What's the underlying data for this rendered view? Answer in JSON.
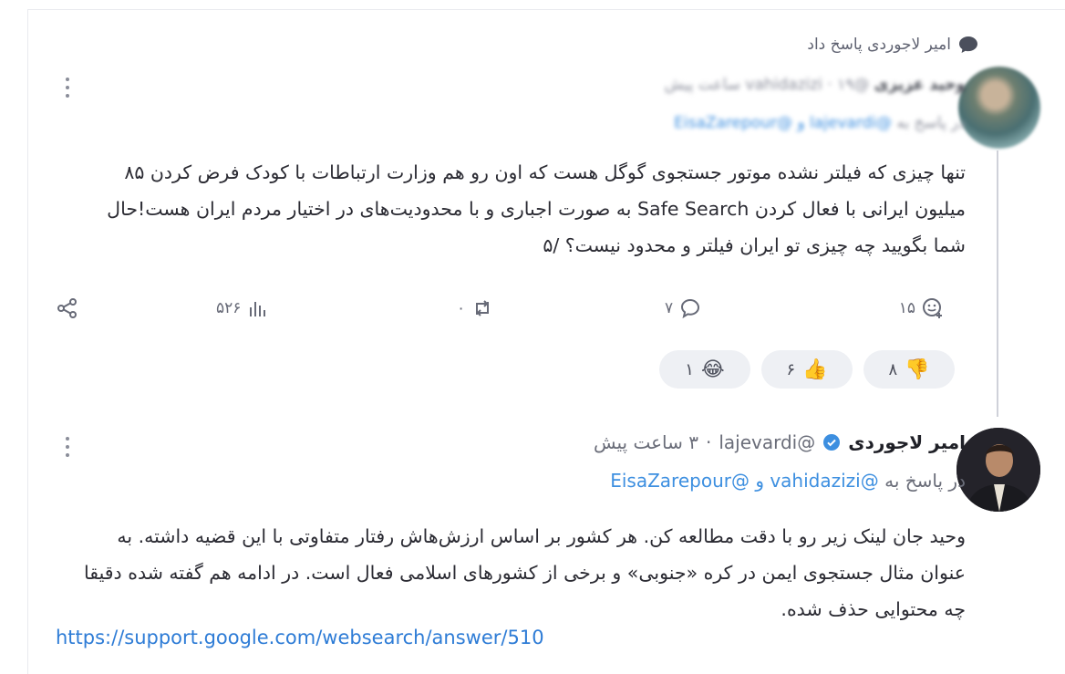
{
  "header": {
    "replied_text": "امیر لاجوردی پاسخ داد"
  },
  "tweet1": {
    "author_name": "وحید عزیزی",
    "handle": "@vahidazizi",
    "time": "۱۹ ساعت پیش",
    "reply_prefix": "در پاسخ به",
    "reply_mentions": "@lajevardi و @EisaZarepour",
    "body": "تنها چیزی که فیلتر نشده موتور جستجوی گوگل هست که اون رو هم وزارت ارتباطات با کودک فرض کردن ۸۵ میلیون ایرانی با فعال کردن Safe Search به صورت اجباری و با محدودیت‌های در اختیار مردم ایران هست!حال شما بگویید چه چیزی تو ایران فیلتر و محدود نیست؟ /۵",
    "actions": {
      "reactions_count": "۱۵",
      "replies_count": "۷",
      "retweets_count": "۰",
      "views_count": "۵۲۶"
    },
    "reactions": [
      {
        "emoji": "👎",
        "count": "۸"
      },
      {
        "emoji": "👍",
        "count": "۶"
      },
      {
        "emoji": "😂",
        "count": "۱"
      }
    ]
  },
  "tweet2": {
    "author_name": "امیر لاجوردی",
    "handle": "@lajevardi",
    "separator": "·",
    "time": "۳ ساعت پیش",
    "reply_prefix": "در پاسخ به",
    "reply_mentions": "@vahidazizi و @EisaZarepour",
    "body": "وحید جان لینک زیر رو با دقت مطالعه کن. هر کشور بر اساس ارزش‌هاش رفتار متفاوتی با این قضیه داشته. به عنوان مثال جستجوی ایمن در کره «جنوبی» و برخی از کشورهای اسلامی فعال است. در ادامه هم گفته شده دقیقا چه محتوایی حذف شده.",
    "link": "https://support.google.com/websearch/answer/510"
  },
  "colors": {
    "accent": "#3d8fe0",
    "link": "#2e7cd6",
    "reaction_bg": "#eef0f4"
  }
}
